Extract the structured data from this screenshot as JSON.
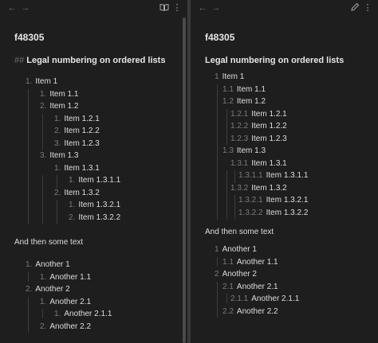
{
  "title": "f48305",
  "heading_marker": "##",
  "heading": "Legal numbering on ordered lists",
  "paragraph": "And then some text",
  "icons": {
    "back": "arrow-left-icon",
    "forward": "arrow-right-icon",
    "reading": "book-open-icon",
    "more": "more-vertical-icon",
    "edit": "pencil-icon"
  },
  "left_list1": [
    {
      "n": "1.",
      "t": "Item 1"
    },
    {
      "n": "1.",
      "t": "Item 1.1"
    },
    {
      "n": "2.",
      "t": "Item 1.2"
    },
    {
      "n": "1.",
      "t": "Item 1.2.1"
    },
    {
      "n": "2.",
      "t": "Item 1.2.2"
    },
    {
      "n": "3.",
      "t": "Item 1.2.3"
    },
    {
      "n": "3.",
      "t": "Item 1.3"
    },
    {
      "n": "1.",
      "t": "Item 1.3.1"
    },
    {
      "n": "1.",
      "t": "Item 1.3.1.1"
    },
    {
      "n": "2.",
      "t": "Item 1.3.2"
    },
    {
      "n": "1.",
      "t": "Item 1.3.2.1"
    },
    {
      "n": "2.",
      "t": "Item 1.3.2.2"
    }
  ],
  "left_list2": [
    {
      "n": "1.",
      "t": "Another 1"
    },
    {
      "n": "1.",
      "t": "Another 1.1"
    },
    {
      "n": "2.",
      "t": "Another 2"
    },
    {
      "n": "1.",
      "t": "Another 2.1"
    },
    {
      "n": "1.",
      "t": "Another 2.1.1"
    },
    {
      "n": "2.",
      "t": "Another 2.2"
    }
  ],
  "right_list1": [
    {
      "n": "1",
      "t": "Item 1"
    },
    {
      "n": "1.1",
      "t": "Item 1.1"
    },
    {
      "n": "1.2",
      "t": "Item 1.2"
    },
    {
      "n": "1.2.1",
      "t": "Item 1.2.1"
    },
    {
      "n": "1.2.2",
      "t": "Item 1.2.2"
    },
    {
      "n": "1.2.3",
      "t": "Item 1.2.3"
    },
    {
      "n": "1.3",
      "t": "Item 1.3"
    },
    {
      "n": "1.3.1",
      "t": "Item 1.3.1"
    },
    {
      "n": "1.3.1.1",
      "t": "Item 1.3.1.1"
    },
    {
      "n": "1.3.2",
      "t": "Item 1.3.2"
    },
    {
      "n": "1.3.2.1",
      "t": "Item 1.3.2.1"
    },
    {
      "n": "1.3.2.2",
      "t": "Item 1.3.2.2"
    }
  ],
  "right_list2": [
    {
      "n": "1",
      "t": "Another 1"
    },
    {
      "n": "1.1",
      "t": "Another 1.1"
    },
    {
      "n": "2",
      "t": "Another 2"
    },
    {
      "n": "2.1",
      "t": "Another 2.1"
    },
    {
      "n": "2.1.1",
      "t": "Another 2.1.1"
    },
    {
      "n": "2.2",
      "t": "Another 2.2"
    }
  ]
}
